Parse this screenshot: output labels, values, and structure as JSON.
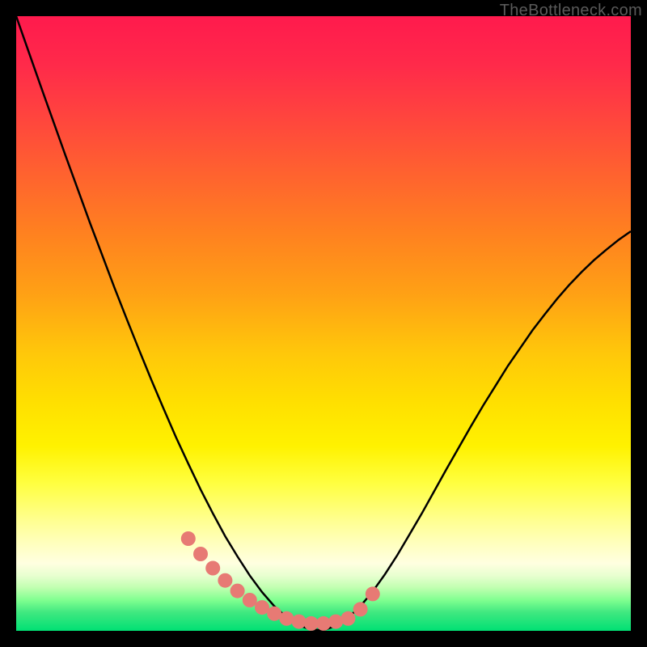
{
  "watermark": "TheBottleneck.com",
  "colors": {
    "background": "#000000",
    "curve": "#000000",
    "marker": "#e77a74",
    "gradient_top": "#ff1a4d",
    "gradient_mid": "#ffe000",
    "gradient_bottom": "#00e074"
  },
  "chart_data": {
    "type": "line",
    "title": "",
    "xlabel": "",
    "ylabel": "",
    "xlim": [
      0,
      100
    ],
    "ylim": [
      0,
      100
    ],
    "grid": false,
    "legend": "none",
    "x": [
      0,
      2,
      4,
      6,
      8,
      10,
      12,
      14,
      16,
      18,
      20,
      22,
      24,
      26,
      28,
      30,
      32,
      34,
      36,
      38,
      40,
      42,
      44,
      46,
      48,
      50,
      52,
      54,
      56,
      58,
      60,
      62,
      64,
      66,
      68,
      70,
      72,
      74,
      76,
      78,
      80,
      82,
      84,
      86,
      88,
      90,
      92,
      94,
      96,
      98,
      100
    ],
    "y": [
      100,
      94.3,
      88.6,
      83.0,
      77.4,
      71.9,
      66.4,
      61.1,
      55.8,
      50.7,
      45.7,
      40.8,
      36.1,
      31.5,
      27.2,
      23.0,
      19.1,
      15.4,
      12.1,
      9.0,
      6.3,
      4.0,
      2.2,
      0.9,
      0.2,
      0.1,
      0.8,
      2.1,
      4.0,
      6.4,
      9.2,
      12.3,
      15.7,
      19.1,
      22.7,
      26.3,
      29.8,
      33.3,
      36.7,
      39.9,
      43.1,
      46.0,
      48.9,
      51.5,
      54.0,
      56.3,
      58.4,
      60.3,
      62.0,
      63.6,
      65.0
    ],
    "markers_x": [
      28,
      30,
      32,
      34,
      36,
      38,
      40,
      42,
      44,
      46,
      48,
      50,
      52,
      54,
      56,
      58
    ],
    "markers_y": [
      15.0,
      12.5,
      10.2,
      8.2,
      6.5,
      5.0,
      3.8,
      2.8,
      2.0,
      1.5,
      1.2,
      1.2,
      1.5,
      2.0,
      3.5,
      6.0
    ]
  }
}
